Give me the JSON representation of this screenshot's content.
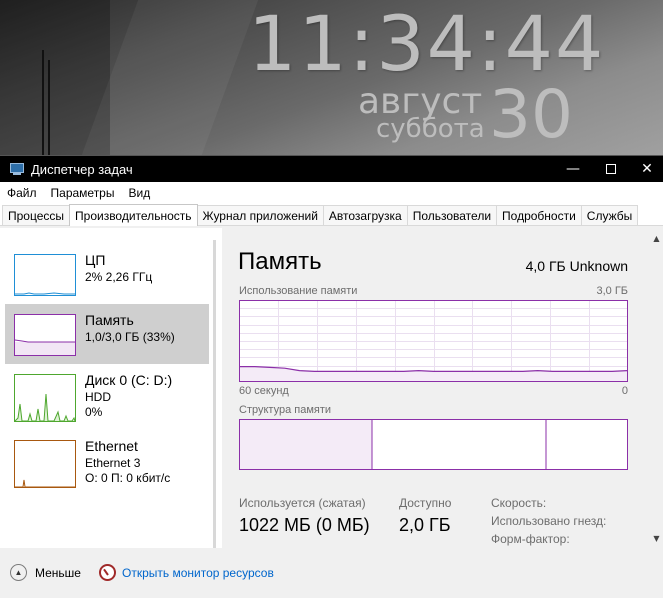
{
  "desktop": {
    "clock_time": "11:34:44",
    "clock_month": "август",
    "clock_weekday": "суббота",
    "clock_day": "30"
  },
  "window": {
    "title": "Диспетчер задач",
    "minimize_glyph": "—",
    "close_glyph": "✕"
  },
  "menu": [
    "Файл",
    "Параметры",
    "Вид"
  ],
  "tabs": [
    {
      "label": "Процессы",
      "active": false
    },
    {
      "label": "Производительность",
      "active": true
    },
    {
      "label": "Журнал приложений",
      "active": false
    },
    {
      "label": "Автозагрузка",
      "active": false
    },
    {
      "label": "Пользователи",
      "active": false
    },
    {
      "label": "Подробности",
      "active": false
    },
    {
      "label": "Службы",
      "active": false
    }
  ],
  "sidebar": {
    "items": [
      {
        "name": "ЦП",
        "sub1": "2% 2,26 ГГц",
        "sub2": "",
        "color": "#1f8fd6"
      },
      {
        "name": "Память",
        "sub1": "1,0/3,0 ГБ (33%)",
        "sub2": "",
        "color": "#8b2fa8"
      },
      {
        "name": "Диск 0 (C: D:)",
        "sub1": "HDD",
        "sub2": "0%",
        "color": "#4ea72e"
      },
      {
        "name": "Ethernet",
        "sub1": "Ethernet 3",
        "sub2": "О: 0 П: 0 кбит/с",
        "color": "#a8580f"
      }
    ]
  },
  "memory": {
    "title": "Память",
    "total": "4,0 ГБ Unknown",
    "usage_label": "Использование памяти",
    "usage_max": "3,0 ГБ",
    "time_label": "60 секунд",
    "time_zero": "0",
    "structure_label": "Структура памяти",
    "stats": {
      "in_use_label": "Используется (сжатая)",
      "in_use_value": "1022 МБ (0 МБ)",
      "available_label": "Доступно",
      "available_value": "2,0 ГБ",
      "speed_label": "Скорость:",
      "slots_label": "Использовано гнезд:",
      "form_label": "Форм-фактор:"
    },
    "accent": "#8b2fa8",
    "usage_fraction": [
      0.18,
      0.18,
      0.17,
      0.16,
      0.13,
      0.12,
      0.12,
      0.12,
      0.12,
      0.12,
      0.12,
      0.12,
      0.13,
      0.12,
      0.12,
      0.12,
      0.12,
      0.12,
      0.12,
      0.12,
      0.13,
      0.12,
      0.12,
      0.12,
      0.12,
      0.12,
      0.13
    ]
  },
  "footer": {
    "less_label": "Меньше",
    "resmon_label": "Открыть монитор ресурсов"
  }
}
